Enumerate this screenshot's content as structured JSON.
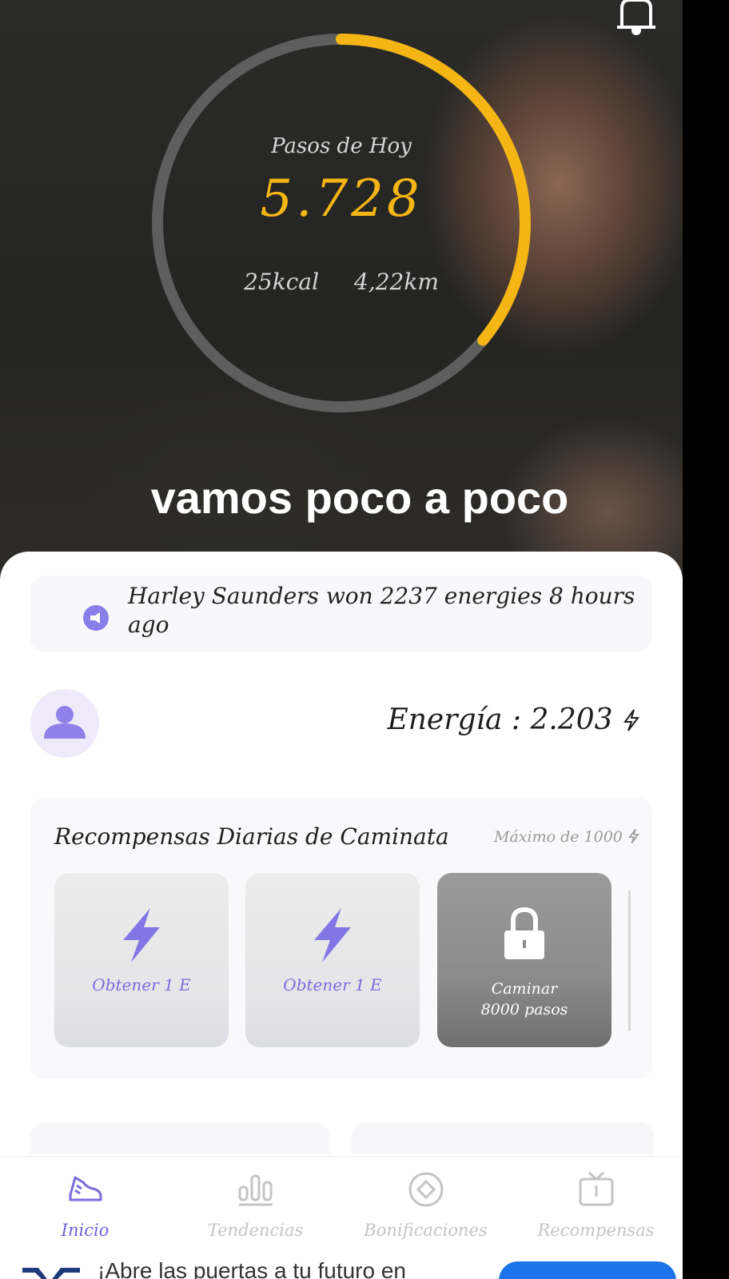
{
  "header": {
    "bell_icon": "bell-icon"
  },
  "progress": {
    "title": "Pasos de Hoy",
    "steps": "5.728",
    "kcal": "25kcal",
    "distance": "4,22km",
    "fraction_of_goal": 0.36,
    "accent_color": "#f5b515",
    "track_color": "#5e5e5e"
  },
  "motto": "vamos poco a poco",
  "ticker": {
    "icon": "megaphone-icon",
    "text": "Harley Saunders won 2237 energies 8 hours ago"
  },
  "profile": {
    "avatar_icon": "user-icon",
    "energy_label": "Energía : 2.203"
  },
  "rewards": {
    "title": "Recompensas Diarias de Caminata",
    "max_label": "Máximo de 1000",
    "cards": [
      {
        "icon": "lightning-icon",
        "label": "Obtener 1 E",
        "locked": false
      },
      {
        "icon": "lightning-icon",
        "label": "Obtener 1 E",
        "locked": false
      },
      {
        "icon": "lock-icon",
        "label_line1": "Caminar",
        "label_line2": "8000 pasos",
        "locked": true
      }
    ]
  },
  "nav": {
    "items": [
      {
        "label": "Inicio",
        "icon": "sneaker-icon",
        "active": true
      },
      {
        "label": "Tendencias",
        "icon": "bar-chart-icon",
        "active": false
      },
      {
        "label": "Bonificaciones",
        "icon": "target-icon",
        "active": false
      },
      {
        "label": "Recompensas",
        "icon": "tv-icon",
        "active": false
      }
    ]
  },
  "ad": {
    "text": "¡Abre las puertas a tu futuro en",
    "button_color": "#1a73e8"
  }
}
